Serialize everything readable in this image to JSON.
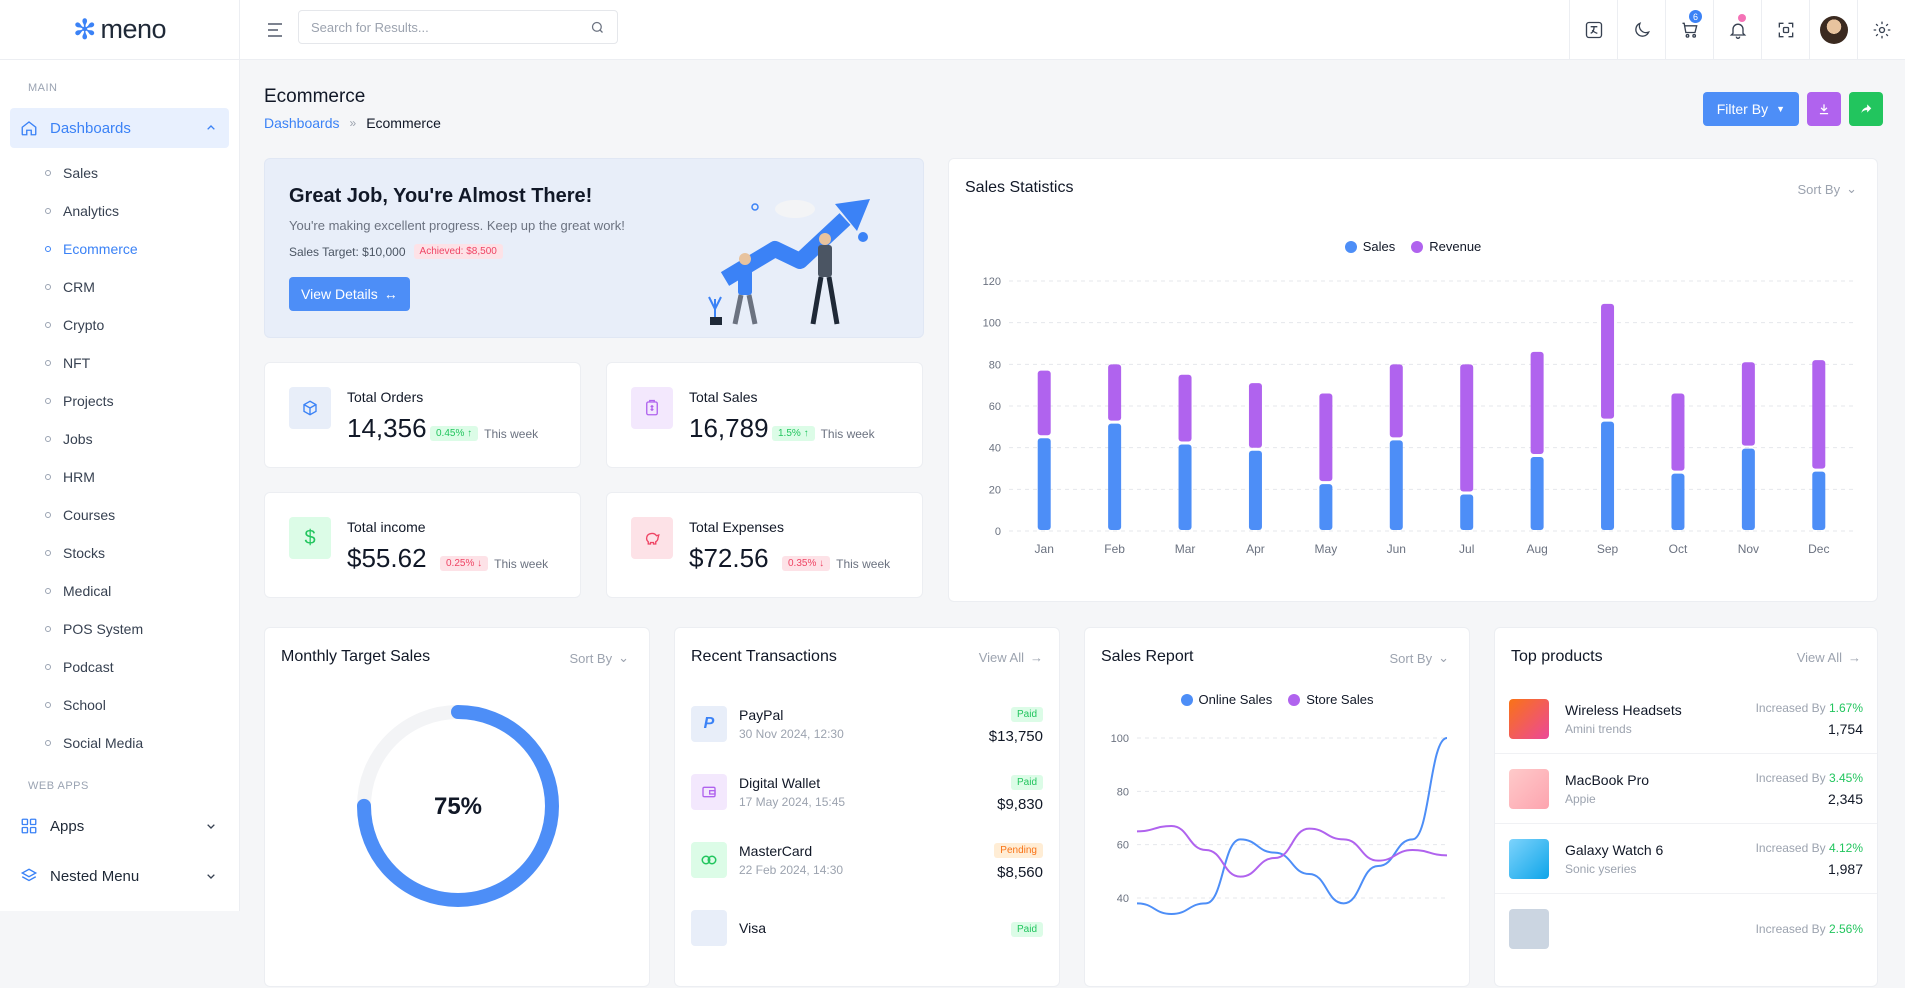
{
  "brand": {
    "name": "meno"
  },
  "sidebar": {
    "section_main": "MAIN",
    "dashboards_label": "Dashboards",
    "items": [
      "Sales",
      "Analytics",
      "Ecommerce",
      "CRM",
      "Crypto",
      "NFT",
      "Projects",
      "Jobs",
      "HRM",
      "Courses",
      "Stocks",
      "Medical",
      "POS System",
      "Podcast",
      "School",
      "Social Media"
    ],
    "active_item": "Ecommerce",
    "section_web_apps": "WEB APPS",
    "apps_label": "Apps",
    "nested_label": "Nested Menu"
  },
  "header": {
    "search_placeholder": "Search for Results...",
    "cart_count": "6"
  },
  "page": {
    "title": "Ecommerce",
    "crumb_root": "Dashboards",
    "crumb_sep": "»",
    "crumb_current": "Ecommerce",
    "filter_label": "Filter By"
  },
  "hero": {
    "title": "Great Job, You're Almost There!",
    "subtitle": "You're making excellent progress. Keep up the great work!",
    "target": "Sales Target: $10,000",
    "achieved": "Achieved: $8,500",
    "button": "View Details"
  },
  "stats": [
    {
      "label": "Total Orders",
      "value": "14,356",
      "change": "0.45%",
      "direction": "up",
      "period": "This week"
    },
    {
      "label": "Total Sales",
      "value": "16,789",
      "change": "1.5%",
      "direction": "up",
      "period": "This week"
    },
    {
      "label": "Total income",
      "value": "$55.62",
      "change": "0.25%",
      "direction": "down",
      "period": "This week"
    },
    {
      "label": "Total Expenses",
      "value": "$72.56",
      "change": "0.35%",
      "direction": "down",
      "period": "This week"
    }
  ],
  "sort_label": "Sort By",
  "view_all_label": "View All",
  "chart_data": [
    {
      "type": "bar",
      "title": "Sales Statistics",
      "stacked": true,
      "categories": [
        "Jan",
        "Feb",
        "Mar",
        "Apr",
        "May",
        "Jun",
        "Jul",
        "Aug",
        "Sep",
        "Oct",
        "Nov",
        "Dec"
      ],
      "series": [
        {
          "name": "Sales",
          "color": "#4d8ef7",
          "values": [
            45,
            52,
            42,
            39,
            23,
            44,
            18,
            36,
            53,
            28,
            40,
            29
          ]
        },
        {
          "name": "Revenue",
          "color": "#b063ee",
          "values": [
            32,
            28,
            33,
            32,
            43,
            36,
            62,
            50,
            56,
            38,
            41,
            53
          ]
        }
      ],
      "ylim": [
        0,
        120
      ],
      "yticks": [
        0,
        20,
        40,
        60,
        80,
        100,
        120
      ],
      "grid": true,
      "legend": "top-center"
    },
    {
      "type": "line",
      "title": "Sales Report",
      "series": [
        {
          "name": "Online Sales",
          "color": "#4d8ef7",
          "values": [
            38,
            34,
            38,
            62,
            57,
            49,
            38,
            52,
            62,
            100
          ]
        },
        {
          "name": "Store Sales",
          "color": "#b063ee",
          "values": [
            65,
            67,
            58,
            48,
            55,
            66,
            62,
            54,
            58,
            56
          ]
        }
      ],
      "ylim": [
        40,
        100
      ],
      "yticks": [
        40,
        60,
        80,
        100
      ],
      "grid": true,
      "legend": "top-center"
    }
  ],
  "monthly": {
    "title": "Monthly Target Sales",
    "percent_label": "75%",
    "percent": 75
  },
  "transactions": {
    "title": "Recent Transactions",
    "items": [
      {
        "name": "PayPal",
        "date": "30 Nov 2024, 12:30",
        "status": "Paid",
        "amount": "$13,750"
      },
      {
        "name": "Digital Wallet",
        "date": "17 May 2024, 15:45",
        "status": "Paid",
        "amount": "$9,830"
      },
      {
        "name": "MasterCard",
        "date": "22 Feb 2024, 14:30",
        "status": "Pending",
        "amount": "$8,560"
      },
      {
        "name": "Visa",
        "date": "",
        "status": "Paid",
        "amount": ""
      }
    ]
  },
  "products": {
    "title": "Top products",
    "increased_label": "Increased By",
    "items": [
      {
        "name": "Wireless Headsets",
        "brand": "Amini trends",
        "pct": "1.67%",
        "qty": "1,754"
      },
      {
        "name": "MacBook Pro",
        "brand": "Appie",
        "pct": "3.45%",
        "qty": "2,345"
      },
      {
        "name": "Galaxy Watch 6",
        "brand": "Sonic yseries",
        "pct": "4.12%",
        "qty": "1,987"
      },
      {
        "name": "",
        "brand": "",
        "pct": "2.56%",
        "qty": ""
      }
    ]
  }
}
